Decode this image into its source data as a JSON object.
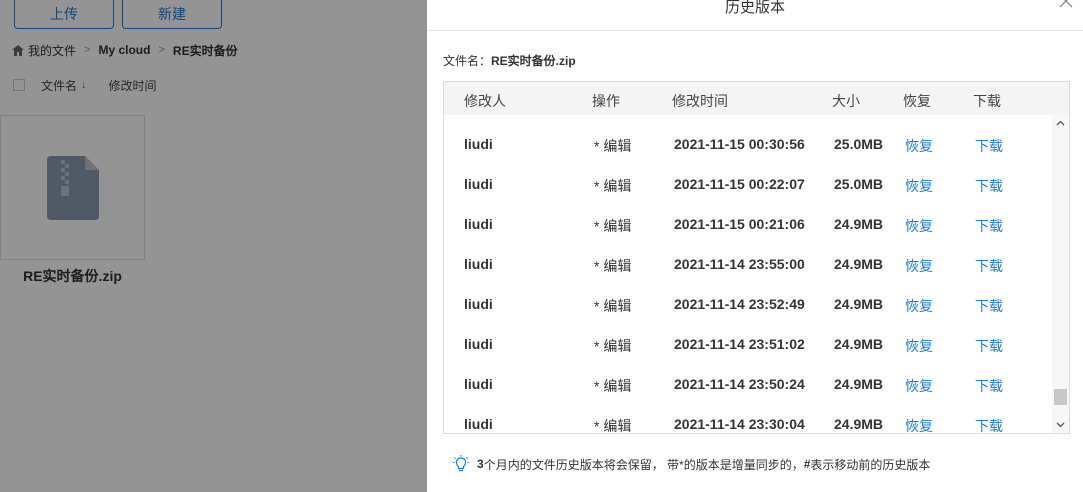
{
  "background": {
    "upload_label": "上传",
    "new_label": "新建",
    "breadcrumb": [
      "我的文件",
      "My cloud",
      "RE实时备份"
    ],
    "breadcrumb_sep": ">",
    "col_name": "文件名",
    "col_mtime": "修改时间",
    "sort_icon": "arrow-down-icon",
    "file_name": "RE实时备份.zip"
  },
  "drawer": {
    "title": "历史版本",
    "file_label_prefix": "文件名：",
    "file_label_value": "RE实时备份.zip",
    "columns": [
      "修改人",
      "操作",
      "修改时间",
      "大小",
      "恢复",
      "下载"
    ],
    "rows": [
      {
        "user": "liudi",
        "action": "* 编辑",
        "time": "2021-11-15 00:30:56",
        "size": "25.0MB",
        "restore": "恢复",
        "download": "下载"
      },
      {
        "user": "liudi",
        "action": "* 编辑",
        "time": "2021-11-15 00:22:07",
        "size": "25.0MB",
        "restore": "恢复",
        "download": "下载"
      },
      {
        "user": "liudi",
        "action": "* 编辑",
        "time": "2021-11-15 00:21:06",
        "size": "24.9MB",
        "restore": "恢复",
        "download": "下载"
      },
      {
        "user": "liudi",
        "action": "* 编辑",
        "time": "2021-11-14 23:55:00",
        "size": "24.9MB",
        "restore": "恢复",
        "download": "下载"
      },
      {
        "user": "liudi",
        "action": "* 编辑",
        "time": "2021-11-14 23:52:49",
        "size": "24.9MB",
        "restore": "恢复",
        "download": "下载"
      },
      {
        "user": "liudi",
        "action": "* 编辑",
        "time": "2021-11-14 23:51:02",
        "size": "24.9MB",
        "restore": "恢复",
        "download": "下载"
      },
      {
        "user": "liudi",
        "action": "* 编辑",
        "time": "2021-11-14 23:50:24",
        "size": "24.9MB",
        "restore": "恢复",
        "download": "下载"
      },
      {
        "user": "liudi",
        "action": "* 编辑",
        "time": "2021-11-14 23:30:04",
        "size": "24.9MB",
        "restore": "恢复",
        "download": "下载"
      }
    ],
    "footer": {
      "bold1": "3",
      "text1": "个月内的文件历史版本将会保留， 带*的版本是增量同步的， ",
      "bold2": "#",
      "text2": "表示移动前的历史版本"
    }
  },
  "colors": {
    "accent": "#1e7cd9",
    "overlay": "rgba(0,0,0,0.42)",
    "text": "#333333"
  }
}
